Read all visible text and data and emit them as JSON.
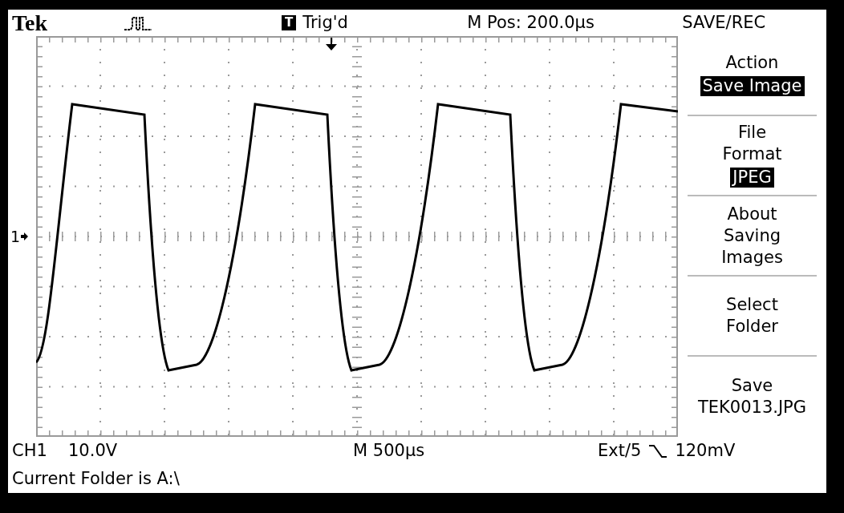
{
  "header": {
    "brand": "Tek",
    "trigger_badge": "T",
    "trigger_status": "Trig'd",
    "position": "M Pos: 200.0µs",
    "menu_title": "SAVE/REC"
  },
  "channel_marker": "1",
  "menu": [
    {
      "lines": [
        "Action"
      ],
      "value": "Save Image"
    },
    {
      "lines": [
        "File",
        "Format"
      ],
      "value": "JPEG"
    },
    {
      "lines": [
        "About",
        "Saving",
        "Images"
      ]
    },
    {
      "lines": [
        "Select",
        "Folder"
      ]
    },
    {
      "lines": [
        "Save",
        "TEK0013.JPG"
      ]
    }
  ],
  "readout": {
    "channel": "CH1",
    "scale": "10.0V",
    "timebase": "M 500µs",
    "trigger_source": "Ext/5",
    "trigger_level": "120mV"
  },
  "status": "Current Folder is A:\\"
}
